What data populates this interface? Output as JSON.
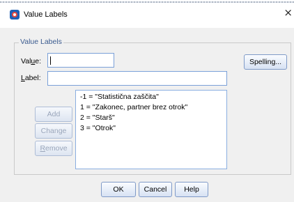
{
  "window": {
    "title": "Value Labels",
    "close_glyph": "×",
    "icon": "spss-app-icon"
  },
  "group": {
    "legend": "Value Labels"
  },
  "value_field": {
    "label_pre": "Val",
    "label_mnemonic": "u",
    "label_post": "e:",
    "value": ""
  },
  "label_field": {
    "label_mnemonic": "L",
    "label_post": "abel:",
    "value": ""
  },
  "buttons": {
    "spelling": "Spelling...",
    "add": "Add",
    "change": "Change",
    "remove_mnemonic": "R",
    "remove_rest": "emove",
    "ok": "OK",
    "cancel": "Cancel",
    "help": "Help"
  },
  "labels_list": [
    "-1 = \"Statistična zaščita\"",
    "1 = \"Zakonec, partner brez otrok\"",
    "2 = \"Starš\"",
    "3 = \"Otrok\""
  ]
}
